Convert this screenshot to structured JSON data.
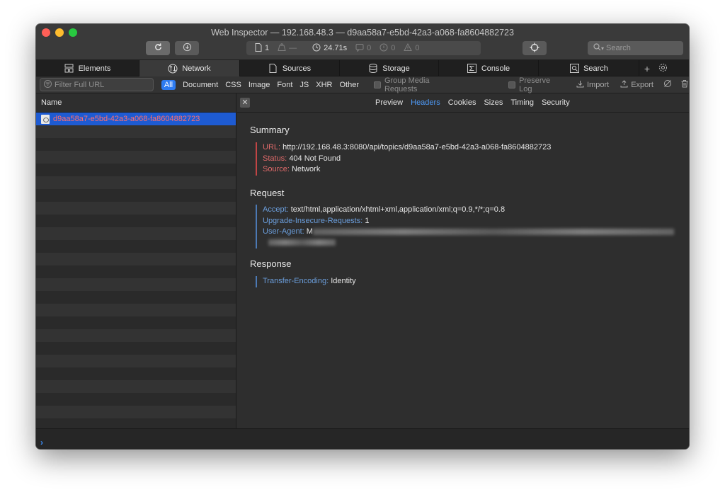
{
  "window": {
    "title": "Web Inspector — 192.168.48.3 — d9aa58a7-e5bd-42a3-a068-fa8604882723"
  },
  "toolbar": {
    "resources_count": "1",
    "transfer_size": "—",
    "load_time": "24.71s",
    "logs_count": "0",
    "errors_count": "0",
    "warnings_count": "0",
    "search_placeholder": "Search"
  },
  "tabs": [
    {
      "label": "Elements",
      "icon": "elements-icon"
    },
    {
      "label": "Network",
      "icon": "network-icon"
    },
    {
      "label": "Sources",
      "icon": "sources-icon"
    },
    {
      "label": "Storage",
      "icon": "storage-icon"
    },
    {
      "label": "Console",
      "icon": "console-icon"
    },
    {
      "label": "Search",
      "icon": "search-icon"
    }
  ],
  "filter": {
    "placeholder": "Filter Full URL",
    "types": [
      "All",
      "Document",
      "CSS",
      "Image",
      "Font",
      "JS",
      "XHR",
      "Other"
    ],
    "active_type": "All",
    "group_media": "Group Media Requests",
    "preserve_log": "Preserve Log",
    "import": "Import",
    "export": "Export"
  },
  "requests": {
    "column_header": "Name",
    "items": [
      {
        "name": "d9aa58a7-e5bd-42a3-a068-fa8604882723"
      }
    ]
  },
  "detail": {
    "subtabs": [
      "Preview",
      "Headers",
      "Cookies",
      "Sizes",
      "Timing",
      "Security"
    ],
    "active_subtab": "Headers",
    "summary": {
      "title": "Summary",
      "url_key": "URL:",
      "url_value": "http://192.168.48.3:8080/api/topics/d9aa58a7-e5bd-42a3-a068-fa8604882723",
      "status_key": "Status:",
      "status_value": "404 Not Found",
      "source_key": "Source:",
      "source_value": "Network"
    },
    "request": {
      "title": "Request",
      "accept_key": "Accept:",
      "accept_value": "text/html,application/xhtml+xml,application/xml;q=0.9,*/*;q=0.8",
      "upgrade_key": "Upgrade-Insecure-Requests:",
      "upgrade_value": "1",
      "ua_key": "User-Agent:",
      "ua_value": "M"
    },
    "response": {
      "title": "Response",
      "te_key": "Transfer-Encoding:",
      "te_value": "Identity"
    }
  },
  "console": {
    "prompt": "›"
  },
  "colors": {
    "accent": "#2d7bf1",
    "selected_row": "#1e5bd2",
    "error_text": "#ff6f6f",
    "summary_key": "#e06a6a",
    "header_key": "#6b9edc"
  }
}
